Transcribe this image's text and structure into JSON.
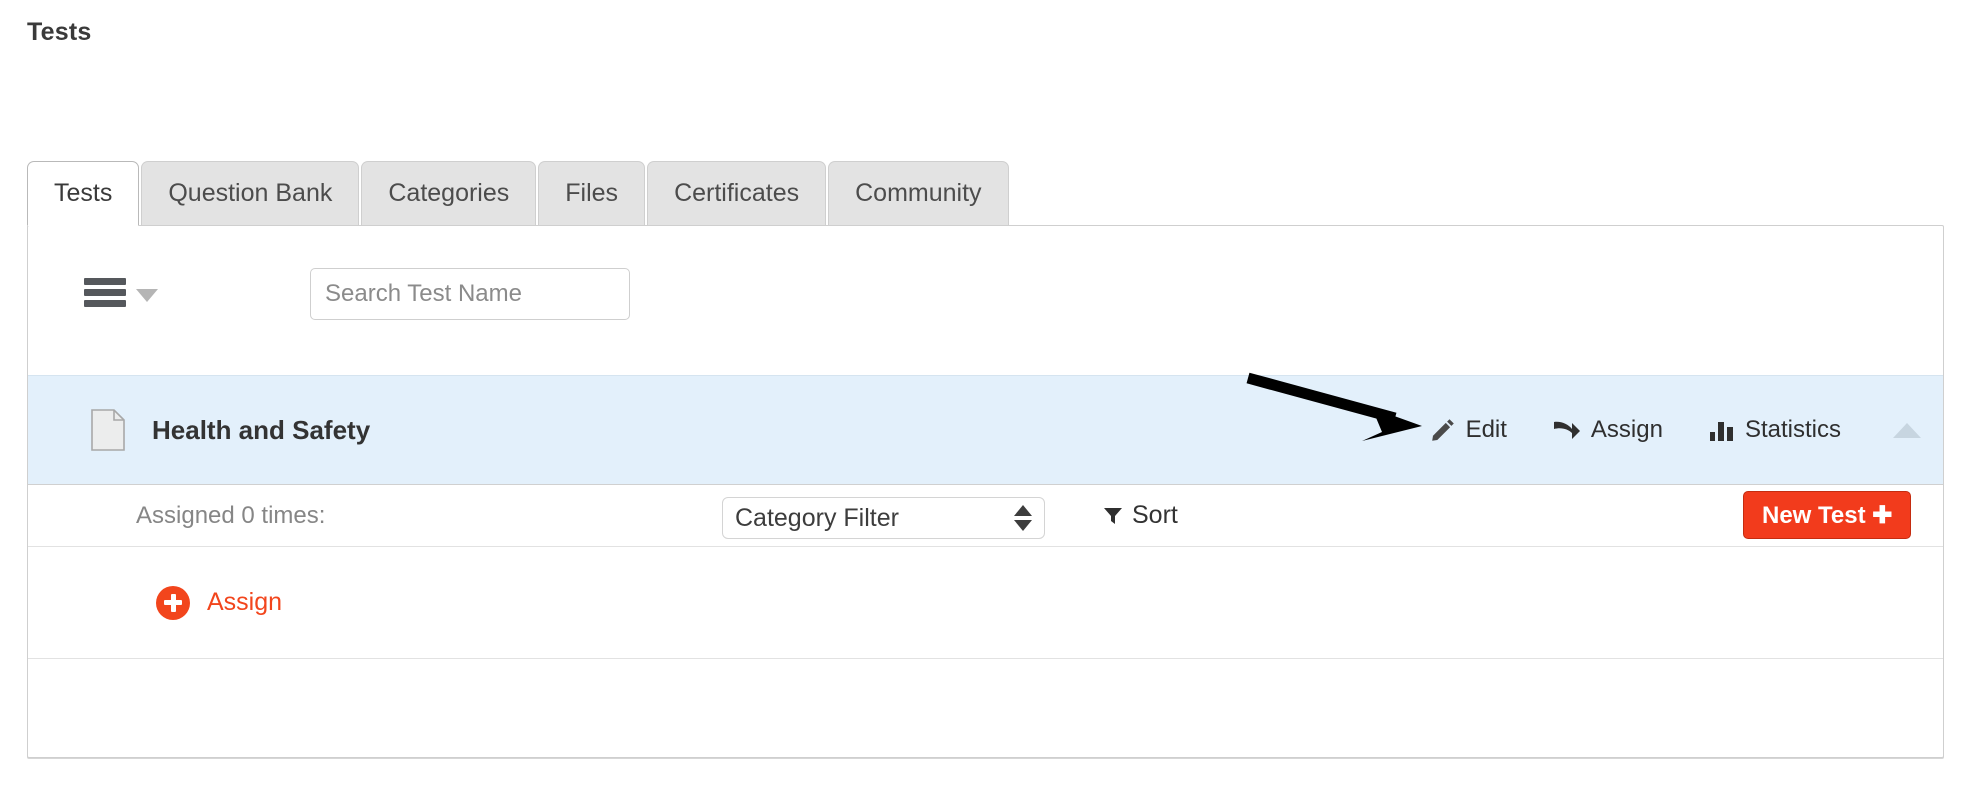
{
  "page": {
    "title": "Tests"
  },
  "tabs": [
    {
      "label": "Tests",
      "active": true
    },
    {
      "label": "Question Bank",
      "active": false
    },
    {
      "label": "Categories",
      "active": false
    },
    {
      "label": "Files",
      "active": false
    },
    {
      "label": "Certificates",
      "active": false
    },
    {
      "label": "Community",
      "active": false
    }
  ],
  "toolbar": {
    "menu_icon": "hamburger-menu-icon",
    "menu_caret_icon": "chevron-down-icon",
    "search": {
      "placeholder": "Search Test Name",
      "value": ""
    },
    "category_filter": {
      "selected": "Category Filter",
      "spinner_icon": "up-down-arrows-icon"
    },
    "sort": {
      "label": "Sort",
      "icon": "funnel-icon"
    },
    "new_test": {
      "label": "New Test ✚"
    }
  },
  "test_row": {
    "doc_icon": "document-icon",
    "name": "Health and Safety",
    "actions": [
      {
        "label": "Edit",
        "icon": "pencil-icon"
      },
      {
        "label": "Assign",
        "icon": "arrow-forward-icon"
      },
      {
        "label": "Statistics",
        "icon": "bar-chart-icon"
      }
    ],
    "collapse_icon": "caret-up-icon"
  },
  "details": {
    "assigned_text": "Assigned 0 times:",
    "assign_link": {
      "label": "Assign",
      "icon": "plus-circle-icon"
    }
  },
  "colors": {
    "accent_red": "#f23b1c",
    "row_highlight": "#e3f0fb",
    "link_orange": "#f2451c"
  }
}
